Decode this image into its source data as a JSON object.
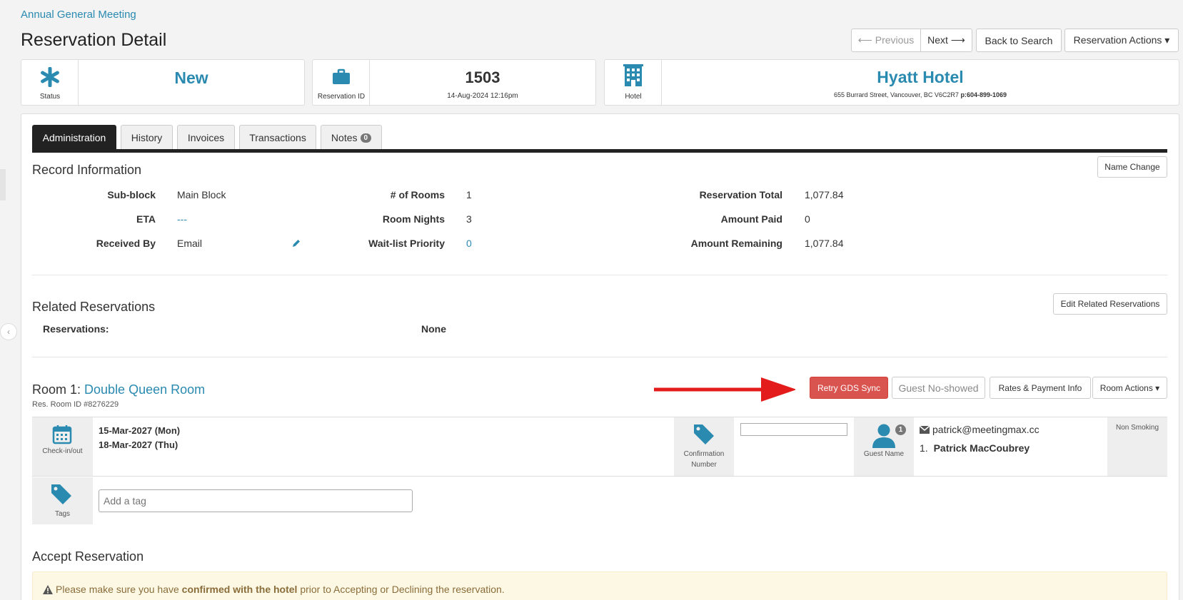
{
  "breadcrumb": "Annual General Meeting",
  "page_title": "Reservation Detail",
  "nav": {
    "previous": "⟵ Previous",
    "next": "Next ⟶",
    "back": "Back to Search",
    "actions": "Reservation Actions ▾"
  },
  "cards": {
    "status": {
      "label": "Status",
      "value": "New",
      "icon": "asterisk-icon"
    },
    "reservation": {
      "label": "Reservation ID",
      "value": "1503",
      "sub": "14-Aug-2024 12:16pm",
      "icon": "briefcase-icon"
    },
    "hotel": {
      "label": "Hotel",
      "value": "Hyatt Hotel",
      "address": "655 Burrard Street, Vancouver, BC V6C2R7",
      "phone_prefix": "p:",
      "phone": "604-899-1069",
      "icon": "building-icon"
    }
  },
  "tabs": [
    {
      "label": "Administration"
    },
    {
      "label": "History"
    },
    {
      "label": "Invoices"
    },
    {
      "label": "Transactions"
    },
    {
      "label": "Notes",
      "badge": "0"
    }
  ],
  "record": {
    "title": "Record Information",
    "name_change": "Name Change",
    "sub_block_label": "Sub-block",
    "sub_block": "Main Block",
    "eta_label": "ETA",
    "eta": "---",
    "received_label": "Received By",
    "received": "Email",
    "rooms_label": "# of Rooms",
    "rooms": "1",
    "nights_label": "Room Nights",
    "nights": "3",
    "wait_label": "Wait-list Priority",
    "wait": "0",
    "total_label": "Reservation Total",
    "total": "1,077.84",
    "paid_label": "Amount Paid",
    "paid": "0",
    "remaining_label": "Amount Remaining",
    "remaining": "1,077.84"
  },
  "related": {
    "title": "Related Reservations",
    "edit": "Edit Related Reservations",
    "label": "Reservations:",
    "value": "None"
  },
  "room": {
    "prefix": "Room 1: ",
    "type": "Double Queen Room",
    "res_room_id": "Res. Room ID #8276229",
    "retry": "Retry GDS Sync",
    "no_show": "Guest No-showed",
    "rates": "Rates & Payment Info",
    "actions": "Room Actions ▾",
    "checkin_label": "Check-in/out",
    "checkin": "15-Mar-2027 (Mon)",
    "checkout": "18-Mar-2027 (Thu)",
    "confirmation_label": "Confirmation Number",
    "confirmation_value": "",
    "guest_label": "Guest Name",
    "guest_count": "1",
    "email": "patrick@meetingmax.cc",
    "guest_num": "1.",
    "guest_name": "Patrick MacCoubrey",
    "smoking": "Non Smoking",
    "tags_label": "Tags",
    "tag_placeholder": "Add a tag"
  },
  "accept": {
    "title": "Accept Reservation",
    "msg_pre": "Please make sure you have ",
    "msg_bold": "confirmed with the hotel",
    "msg_post": " prior to Accepting or Declining the reservation."
  },
  "colors": {
    "accent": "#2a8ab0",
    "danger": "#d9534f",
    "arrow": "#e31b1b",
    "warning_bg": "#fcf8e3"
  }
}
